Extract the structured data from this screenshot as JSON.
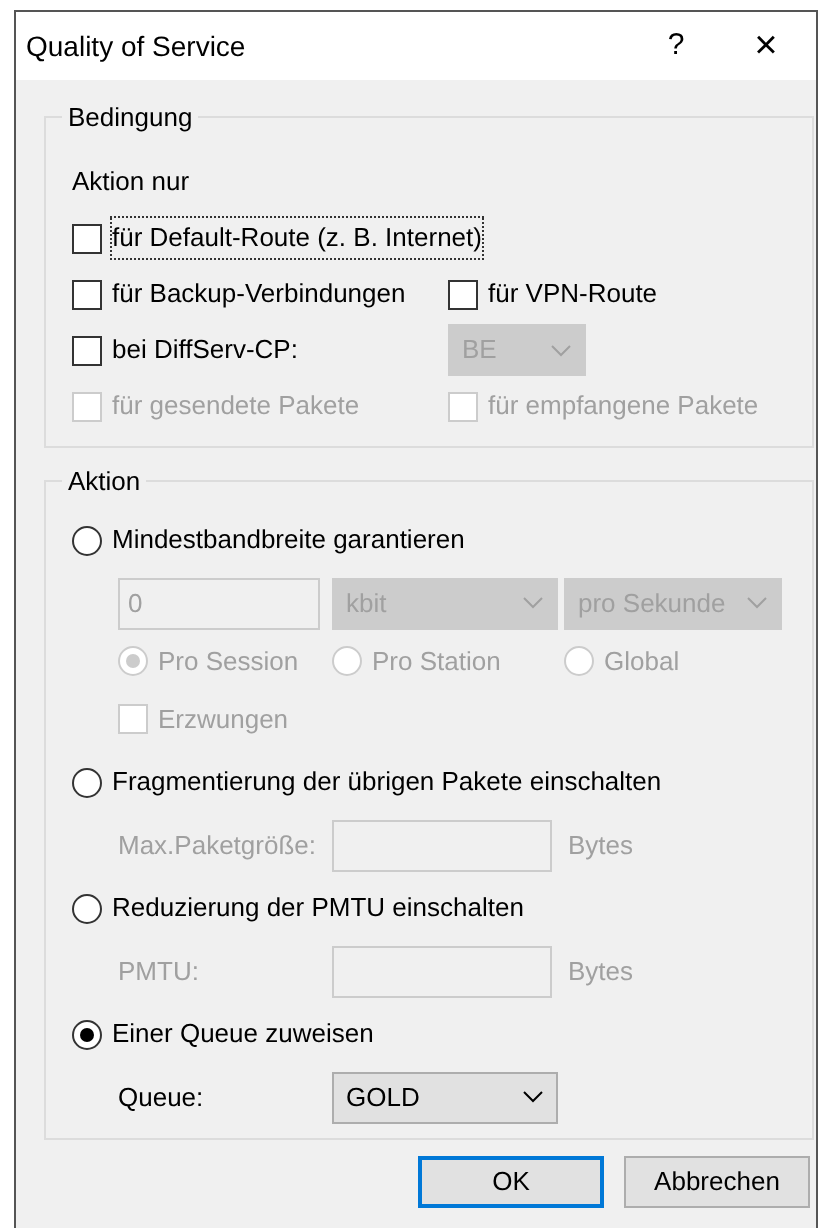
{
  "window": {
    "title": "Quality of Service",
    "help": "?",
    "close": "×"
  },
  "condition": {
    "legend": "Bedingung",
    "intro": "Aktion nur",
    "rows": [
      [
        {
          "kind": "checkbox",
          "label": "für Default-Route (z. B. Internet)",
          "checked": false,
          "disabled": false,
          "focused": true
        }
      ],
      [
        {
          "kind": "checkbox",
          "label": "für Backup-Verbindungen",
          "checked": false,
          "disabled": false,
          "focused": false
        },
        {
          "kind": "checkbox",
          "label": "für VPN-Route",
          "checked": false,
          "disabled": false,
          "focused": false
        }
      ],
      [
        {
          "kind": "checkbox",
          "label": "bei DiffServ-CP:",
          "checked": false,
          "disabled": false,
          "focused": false
        },
        {
          "kind": "dropdown",
          "value": "BE",
          "disabled": true
        }
      ],
      [
        {
          "kind": "checkbox",
          "label": "für gesendete Pakete",
          "checked": false,
          "disabled": true,
          "focused": false
        },
        {
          "kind": "checkbox",
          "label": "für empfangene Pakete",
          "checked": false,
          "disabled": true,
          "focused": false
        }
      ]
    ]
  },
  "action": {
    "legend": "Aktion",
    "options": [
      {
        "label": "Mindestbandbreite garantieren",
        "selected": false,
        "rows": [
          [
            {
              "kind": "input",
              "value": "0",
              "disabled": true
            },
            {
              "kind": "dropdown",
              "value": "kbit",
              "disabled": true
            },
            {
              "kind": "dropdown",
              "value": "pro Sekunde",
              "disabled": true
            }
          ],
          [
            {
              "kind": "radio",
              "label": "Pro Session",
              "selected": true,
              "disabled": true
            },
            {
              "kind": "radio",
              "label": "Pro Station",
              "selected": false,
              "disabled": true
            },
            {
              "kind": "radio",
              "label": "Global",
              "selected": false,
              "disabled": true
            }
          ],
          [
            {
              "kind": "checkbox",
              "label": "Erzwungen",
              "checked": false,
              "disabled": true,
              "focused": false
            }
          ]
        ]
      },
      {
        "label": "Fragmentierung der übrigen Pakete einschalten",
        "selected": false,
        "rows": [
          [
            {
              "kind": "text",
              "label": "Max.Paketgröße:",
              "disabled": true
            },
            {
              "kind": "input",
              "disabled": true
            },
            {
              "kind": "text",
              "label": "Bytes",
              "disabled": true
            }
          ]
        ]
      },
      {
        "label": "Reduzierung der PMTU einschalten",
        "selected": false,
        "rows": [
          [
            {
              "kind": "text",
              "label": "PMTU:",
              "disabled": true
            },
            {
              "kind": "input",
              "disabled": true
            },
            {
              "kind": "text",
              "label": "Bytes",
              "disabled": true
            }
          ]
        ]
      },
      {
        "label": "Einer Queue zuweisen",
        "selected": true,
        "rows": [
          [
            {
              "kind": "text",
              "label": "Queue:",
              "disabled": false
            },
            {
              "kind": "dropdown",
              "value": "GOLD",
              "disabled": false
            }
          ]
        ]
      }
    ]
  },
  "buttons": [
    {
      "label": "OK",
      "default": true
    },
    {
      "label": "Abbrechen",
      "default": false
    }
  ]
}
